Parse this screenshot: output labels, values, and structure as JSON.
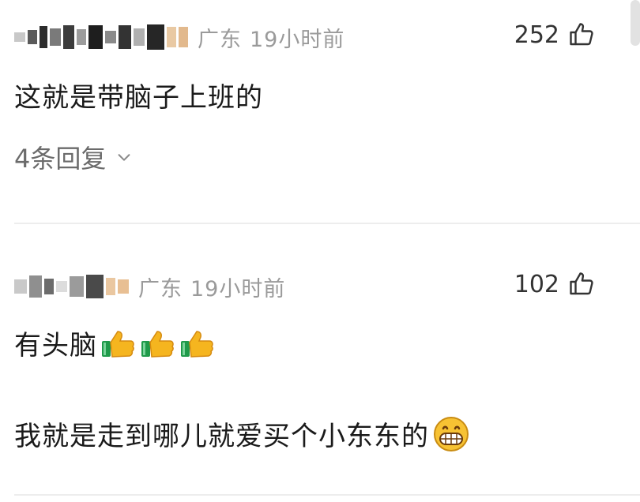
{
  "comments": [
    {
      "location": "广东",
      "time": "19小时前",
      "like_count": "252",
      "text": "这就是带脑子上班的",
      "replies_label": "4条回复"
    },
    {
      "location": "广东",
      "time": "19小时前",
      "like_count": "102",
      "text_line1": "有头脑",
      "text_line2": "我就是走到哪儿就爱买个小东东的"
    }
  ],
  "icons": {
    "like": "thumbs-up-outline-icon",
    "expand": "chevron-down-icon",
    "thumbs_emoji": "thumbs-up-emoji",
    "grin_emoji": "grinning-emoji"
  },
  "colors": {
    "meta_gray": "#9a9a9a",
    "text": "#1a1a1a",
    "reply_gray": "#6b6b6b",
    "divider": "#ededed"
  }
}
